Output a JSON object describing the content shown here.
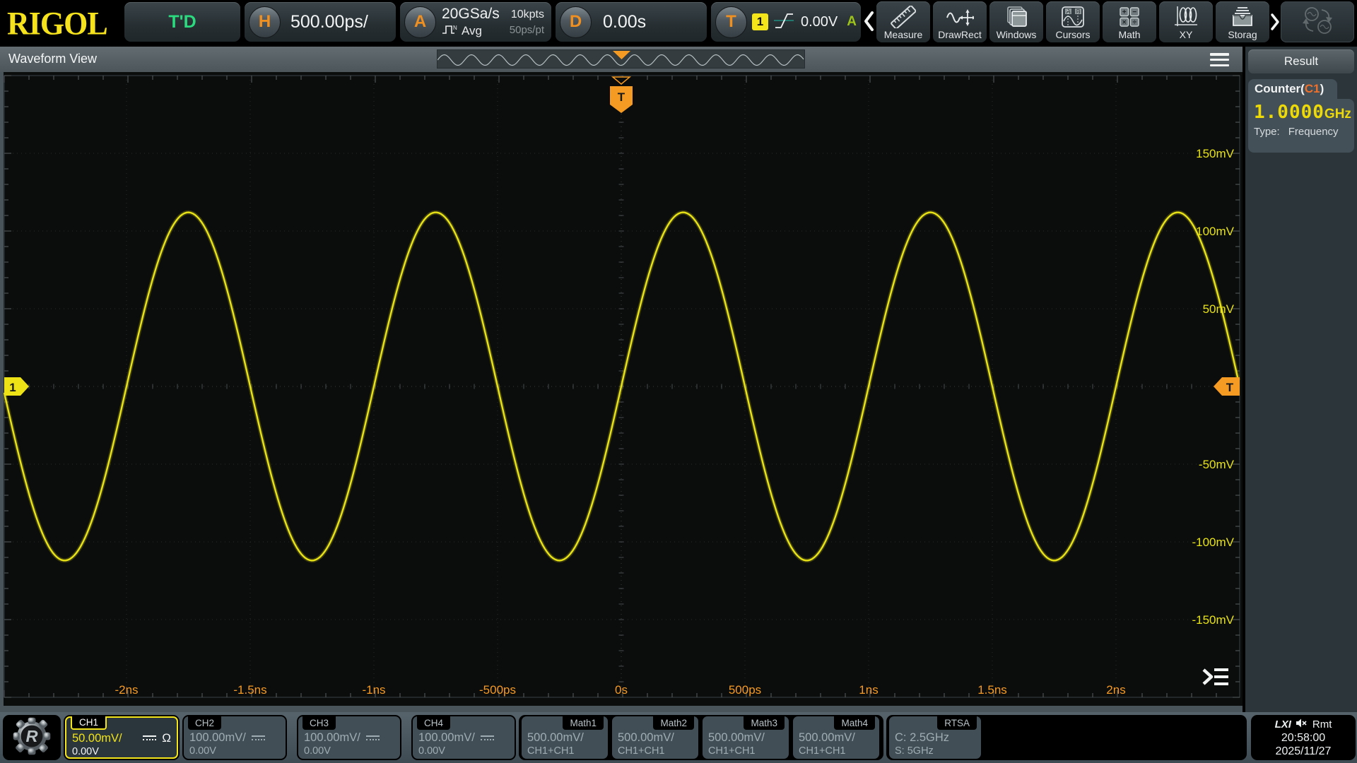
{
  "toolbar": {
    "logo": "RIGOL",
    "trigger_status": "T'D",
    "horizontal": {
      "button_label": "H",
      "timebase": "500.00ps/"
    },
    "acquisition": {
      "button_label": "A",
      "sample_rate": "20GSa/s",
      "mem_depth": "10kpts",
      "acq_mode": "Avg",
      "time_per_pt": "50ps/pt"
    },
    "delay": {
      "button_label": "D",
      "offset": "0.00s"
    },
    "trigger": {
      "button_label": "T",
      "source": "1",
      "level": "0.00V",
      "sweep": "A"
    },
    "menu_items": [
      {
        "label": "Measure",
        "icon": "ruler-icon"
      },
      {
        "label": "DrawRect",
        "icon": "draw-rect-icon"
      },
      {
        "label": "Windows",
        "icon": "windows-icon"
      },
      {
        "label": "Cursors",
        "icon": "cursors-icon"
      },
      {
        "label": "Math",
        "icon": "math-icon"
      },
      {
        "label": "XY",
        "icon": "xy-icon"
      },
      {
        "label": "Storag",
        "icon": "storage-icon"
      }
    ]
  },
  "waveform_view": {
    "title": "Waveform View"
  },
  "chart_data": {
    "type": "line",
    "title": "CH1 sine waveform",
    "x_unit": "ns",
    "y_unit": "mV",
    "x_range_ns": [
      -2.5,
      2.5
    ],
    "y_range_mV": [
      -200,
      200
    ],
    "time_per_div": "500ps",
    "volts_per_div": "50mV",
    "signal": {
      "shape": "sine",
      "amplitude_mV": 112,
      "frequency_GHz": 1.0,
      "offset_mV": 0,
      "rising_zero_cross_ns": 0
    },
    "x_tick_values_ns": [
      -2,
      -1.5,
      -1,
      -0.5,
      0,
      0.5,
      1,
      1.5,
      2
    ],
    "x_tick_labels": [
      "-2ns",
      "-1.5ns",
      "-1ns",
      "-500ps",
      "0s",
      "500ps",
      "1ns",
      "1.5ns",
      "2ns"
    ],
    "y_tick_values_mV": [
      150,
      100,
      50,
      -50,
      -100,
      -150
    ],
    "y_tick_labels": [
      "150mV",
      "100mV",
      "50mV",
      "-50mV",
      "-100mV",
      "-150mV"
    ],
    "trace_color": "#e8e316",
    "x_label_color": "#f59a23",
    "y_label_color": "#e8e316",
    "grid": "dotted"
  },
  "markers": {
    "channel_label": "1",
    "trigger_label": "T"
  },
  "result_panel": {
    "title": "Result",
    "counter": {
      "name_prefix": "Counter(",
      "source": "C1",
      "name_suffix": ")",
      "value": "1.0000",
      "unit": "GHz",
      "type_label": "Type:",
      "type_value": "Frequency"
    }
  },
  "channels": [
    {
      "name": "CH1",
      "scale": "50.00mV/",
      "offset": "0.00V",
      "impedance": "Ω",
      "active": true
    },
    {
      "name": "CH2",
      "scale": "100.00mV/",
      "offset": "0.00V"
    },
    {
      "name": "CH3",
      "scale": "100.00mV/",
      "offset": "0.00V"
    },
    {
      "name": "CH4",
      "scale": "100.00mV/",
      "offset": "0.00V"
    }
  ],
  "maths": [
    {
      "name": "Math1",
      "scale": "500.00mV/",
      "expr": "CH1+CH1"
    },
    {
      "name": "Math2",
      "scale": "500.00mV/",
      "expr": "CH1+CH1"
    },
    {
      "name": "Math3",
      "scale": "500.00mV/",
      "expr": "CH1+CH1"
    },
    {
      "name": "Math4",
      "scale": "500.00mV/",
      "expr": "CH1+CH1"
    }
  ],
  "rtsa": {
    "name": "RTSA",
    "center": "C: 2.5GHz",
    "span": "S: 5GHz"
  },
  "status_bar": {
    "lxi": "LXI",
    "muted": "speaker-muted-icon",
    "rmt": "Rmt",
    "time": "20:58:00",
    "date": "2025/11/27"
  }
}
